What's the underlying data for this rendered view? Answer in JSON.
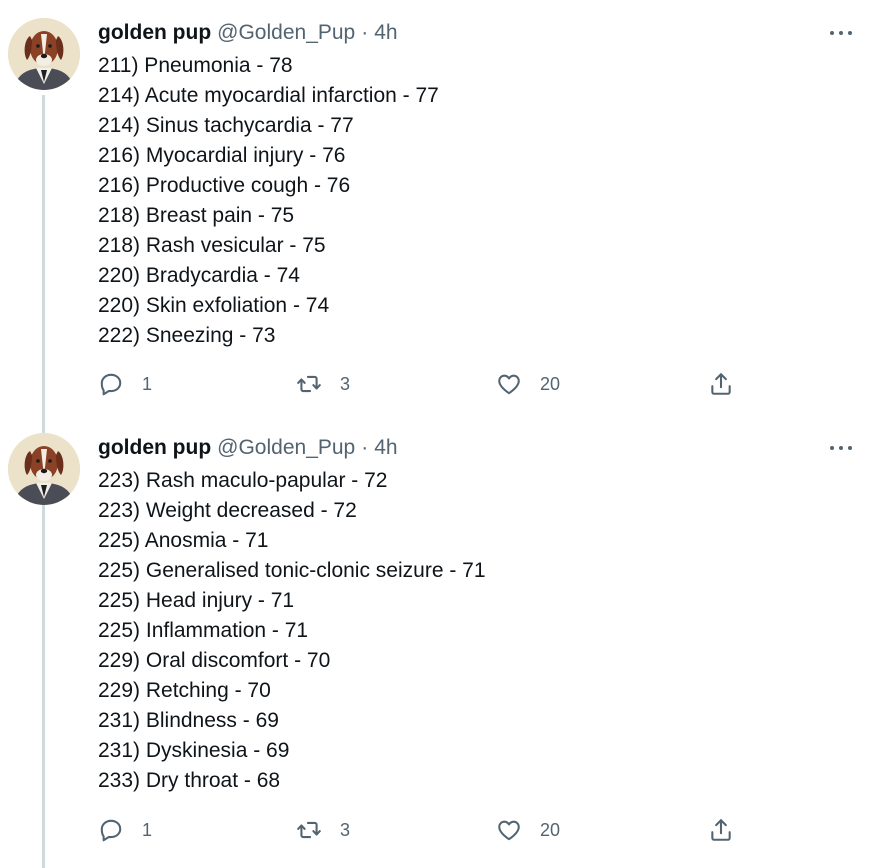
{
  "tweets": [
    {
      "author": {
        "name": "golden pup",
        "handle": "@Golden_Pup"
      },
      "separator": "·",
      "time": "4h",
      "lines": [
        "211) Pneumonia - 78",
        "214) Acute myocardial infarction - 77",
        "214) Sinus tachycardia - 77",
        "216) Myocardial injury - 76",
        "216) Productive cough - 76",
        "218) Breast pain - 75",
        "218) Rash vesicular - 75",
        "220) Bradycardia - 74",
        "220) Skin exfoliation - 74",
        "222) Sneezing - 73"
      ],
      "actions": {
        "replies": "1",
        "retweets": "3",
        "likes": "20"
      }
    },
    {
      "author": {
        "name": "golden pup",
        "handle": "@Golden_Pup"
      },
      "separator": "·",
      "time": "4h",
      "lines": [
        "223) Rash maculo-papular - 72",
        "223) Weight decreased - 72",
        "225) Anosmia - 71",
        "225) Generalised tonic-clonic seizure - 71",
        "225) Head injury - 71",
        "225) Inflammation - 71",
        "229) Oral discomfort - 70",
        "229) Retching - 70",
        "231) Blindness - 69",
        "231) Dyskinesia - 69",
        "233) Dry throat - 68"
      ],
      "actions": {
        "replies": "1",
        "retweets": "3",
        "likes": "20"
      }
    }
  ],
  "icons": {
    "reply": "reply-icon",
    "retweet": "retweet-icon",
    "like": "heart-icon",
    "share": "share-icon",
    "more": "more-icon"
  },
  "colors": {
    "text": "#0f1419",
    "secondary": "#536471",
    "thread_line": "#cfd9de",
    "background": "#ffffff"
  }
}
